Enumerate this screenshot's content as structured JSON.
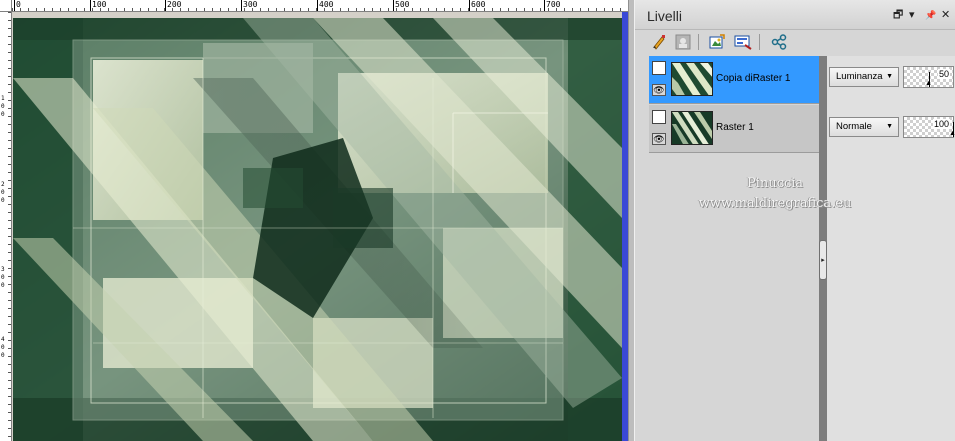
{
  "rulers": {
    "horizontal_labels": [
      "0",
      "100",
      "200",
      "300",
      "400",
      "500",
      "600",
      "700"
    ],
    "vertical_labels": [
      "1",
      "0",
      "0",
      "2",
      "0",
      "0",
      "3",
      "0",
      "0",
      "4",
      "0",
      "0"
    ]
  },
  "panel": {
    "title": "Livelli",
    "controls": {
      "float": "🗗",
      "menu": "▾",
      "pin": "📌",
      "close": "✕"
    }
  },
  "toolbar": {
    "icons": [
      "brush-edit-icon",
      "mask-icon",
      "layer-properties-icon",
      "layer-options-icon",
      "share-icon"
    ]
  },
  "layers": [
    {
      "name": "Copia diRaster 1",
      "blend_mode": "Luminanza",
      "opacity": "50",
      "opacity_fraction": 0.5,
      "selected": true
    },
    {
      "name": "Raster 1",
      "blend_mode": "Normale",
      "opacity": "100",
      "opacity_fraction": 1.0,
      "selected": false
    }
  ],
  "watermark": {
    "name": "Pinuccia",
    "url": "www.maldiregrafica.eu"
  },
  "colors": {
    "selection": "#3399ff",
    "scrollbar": "#3a49d6",
    "canvas_dark": "#12301f",
    "canvas_light": "#e6eed0"
  }
}
